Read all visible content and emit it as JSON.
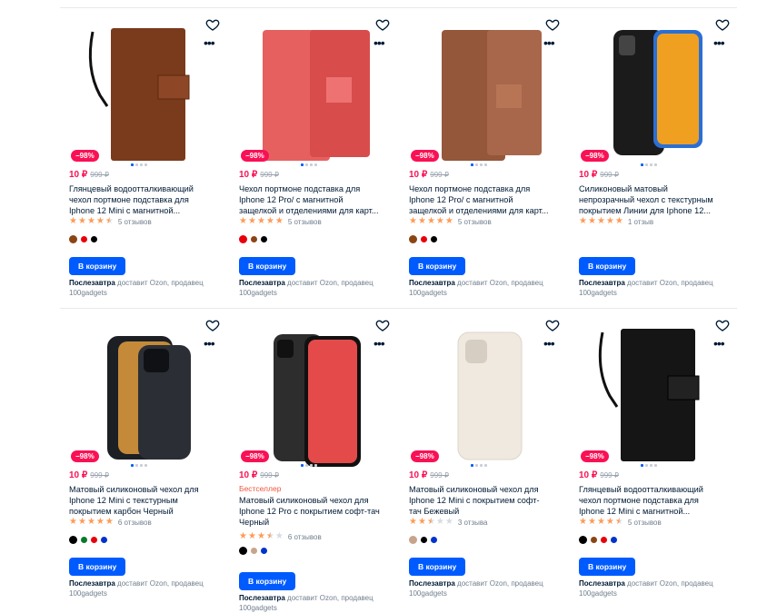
{
  "colors": {
    "accent": "#005bff",
    "discount": "#f91155",
    "star": "#ff9a55"
  },
  "products": [
    {
      "discount": "−98%",
      "price": "10 ₽",
      "old_price": "999 ₽",
      "best": "",
      "title_lines": [
        "Глянцевый водоотталкивающий",
        "чехол портмоне подставка для",
        "Iphone 12 Mini с магнитной..."
      ],
      "stars": "4.5",
      "reviews": "5 отзывов",
      "swatches": [
        "#8b4513",
        "#e8000b",
        "#000000"
      ],
      "cart": "В корзину",
      "delivery": "Послезавтра",
      "delivery_rest": "доставит Ozon, продавец",
      "seller": "100gadgets",
      "image": "brown-wallet-case-with-strap"
    },
    {
      "discount": "−98%",
      "price": "10 ₽",
      "old_price": "999 ₽",
      "best": "",
      "title_lines": [
        "Чехол портмоне подставка для",
        "Iphone 12 Pro/ с магнитной",
        "защелкой и отделениями для карт..."
      ],
      "stars": "5",
      "reviews": "5 отзывов",
      "swatches": [
        "#e8000b",
        "#8b4513",
        "#000000"
      ],
      "cart": "В корзину",
      "delivery": "Послезавтра",
      "delivery_rest": "доставит Ozon, продавец",
      "seller": "100gadgets",
      "image": "red-wallet-case"
    },
    {
      "discount": "−98%",
      "price": "10 ₽",
      "old_price": "999 ₽",
      "best": "",
      "title_lines": [
        "Чехол портмоне подставка для",
        "Iphone 12 Pro/ с магнитной",
        "защелкой и отделениями для карт..."
      ],
      "stars": "5",
      "reviews": "5 отзывов",
      "swatches": [
        "#8b4513",
        "#e8000b",
        "#000000"
      ],
      "cart": "В корзину",
      "delivery": "Послезавтра",
      "delivery_rest": "доставит Ozon, продавец",
      "seller": "100gadgets",
      "image": "brown-wallet-case"
    },
    {
      "discount": "−98%",
      "price": "10 ₽",
      "old_price": "999 ₽",
      "best": "",
      "title_lines": [
        "Силиконовый матовый",
        "непрозрачный чехол с текстурным",
        "покрытием Линии для Iphone 12..."
      ],
      "stars": "5",
      "reviews": "1 отзыв",
      "swatches": [],
      "cart": "В корзину",
      "delivery": "Послезавтра",
      "delivery_rest": "доставит Ozon, продавец",
      "seller": "100gadgets",
      "image": "black-textured-case"
    },
    {
      "discount": "−98%",
      "price": "10 ₽",
      "old_price": "999 ₽",
      "best": "",
      "title_lines": [
        "Матовый силиконовый чехол для",
        "Iphone 12 Mini с текстурным",
        "покрытием карбон Черный"
      ],
      "stars": "5",
      "reviews": "6 отзывов",
      "swatches": [
        "#000000",
        "#0a7a2a",
        "#e8000b",
        "#0033cc"
      ],
      "cart": "В корзину",
      "delivery": "Послезавтра",
      "delivery_rest": "доставит Ozon, продавец",
      "seller": "100gadgets",
      "image": "carbon-black-case"
    },
    {
      "discount": "−98%",
      "price": "10 ₽",
      "old_price": "999 ₽",
      "best": "Бестселлер",
      "title_lines": [
        "Матовый силиконовый чехол для",
        "Iphone 12 Pro с покрытием софт-тач",
        "Черный"
      ],
      "stars": "3.5",
      "reviews": "6 отзывов",
      "swatches": [
        "#000000",
        "#c8a48a",
        "#0033cc"
      ],
      "cart": "В корзину",
      "delivery": "Послезавтра",
      "delivery_rest": "доставит Ozon, продавец",
      "seller": "100gadgets",
      "image": "black-soft-touch-case"
    },
    {
      "discount": "−98%",
      "price": "10 ₽",
      "old_price": "999 ₽",
      "best": "",
      "title_lines": [
        "Матовый силиконовый чехол для",
        "Iphone 12 Mini с покрытием софт-",
        "тач Бежевый"
      ],
      "stars": "2.5",
      "reviews": "3 отзыва",
      "swatches": [
        "#c8a48a",
        "#000000",
        "#0033cc"
      ],
      "cart": "В корзину",
      "delivery": "Послезавтра",
      "delivery_rest": "доставит Ozon, продавец",
      "seller": "100gadgets",
      "image": "beige-case"
    },
    {
      "discount": "−98%",
      "price": "10 ₽",
      "old_price": "999 ₽",
      "best": "",
      "title_lines": [
        "Глянцевый водоотталкивающий",
        "чехол портмоне подставка для",
        "Iphone 12 Mini с магнитной..."
      ],
      "stars": "4.5",
      "reviews": "5 отзывов",
      "swatches": [
        "#000000",
        "#8b4513",
        "#e8000b",
        "#0033cc"
      ],
      "cart": "В корзину",
      "delivery": "Послезавтра",
      "delivery_rest": "доставит Ozon, продавец",
      "seller": "100gadgets",
      "image": "black-wallet-case-with-strap"
    }
  ]
}
